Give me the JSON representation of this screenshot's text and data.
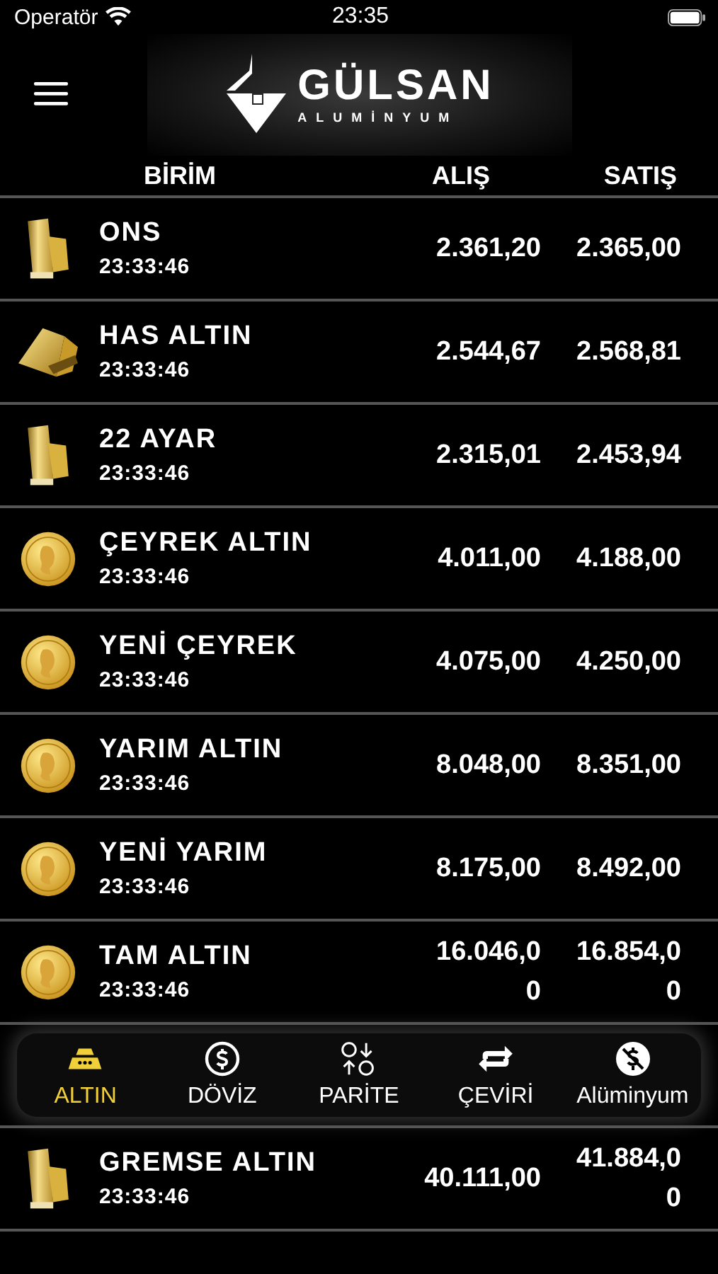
{
  "status_bar": {
    "carrier": "Operatör",
    "time": "23:35"
  },
  "header": {
    "logo_name": "GÜLSAN",
    "logo_tagline": "ALUMİNYUM"
  },
  "table": {
    "columns": [
      "BİRİM",
      "ALIŞ",
      "SATIŞ"
    ],
    "rows": [
      {
        "kind": "bar",
        "name": "ONS",
        "time": "23:33:46",
        "buy": "2.361,20",
        "sell": "2.365,00"
      },
      {
        "kind": "ingot",
        "name": "HAS ALTIN",
        "time": "23:33:46",
        "buy": "2.544,67",
        "sell": "2.568,81"
      },
      {
        "kind": "bar",
        "name": "22 AYAR",
        "time": "23:33:46",
        "buy": "2.315,01",
        "sell": "2.453,94"
      },
      {
        "kind": "coin",
        "name": "ÇEYREK ALTIN",
        "time": "23:33:46",
        "buy": "4.011,00",
        "sell": "4.188,00"
      },
      {
        "kind": "coin",
        "name": "YENİ ÇEYREK",
        "time": "23:33:46",
        "buy": "4.075,00",
        "sell": "4.250,00"
      },
      {
        "kind": "coin",
        "name": "YARIM ALTIN",
        "time": "23:33:46",
        "buy": "8.048,00",
        "sell": "8.351,00"
      },
      {
        "kind": "coin",
        "name": "YENİ YARIM",
        "time": "23:33:46",
        "buy": "8.175,00",
        "sell": "8.492,00"
      },
      {
        "kind": "coin",
        "name": "TAM ALTIN",
        "time": "23:33:46",
        "buy": "16.046,0\n0",
        "sell": "16.854,0\n0"
      },
      {
        "kind": "bar",
        "name": "GREMSE ALTIN",
        "time": "23:33:46",
        "buy": "40.111,00",
        "sell": "41.884,0\n0"
      }
    ]
  },
  "tab_bar": {
    "tabs": [
      {
        "label": "ALTIN",
        "selected": true
      },
      {
        "label": "DÖVİZ",
        "selected": false
      },
      {
        "label": "PARİTE",
        "selected": false
      },
      {
        "label": "ÇEVİRİ",
        "selected": false
      },
      {
        "label": "Alüminyum",
        "selected": false
      }
    ]
  }
}
